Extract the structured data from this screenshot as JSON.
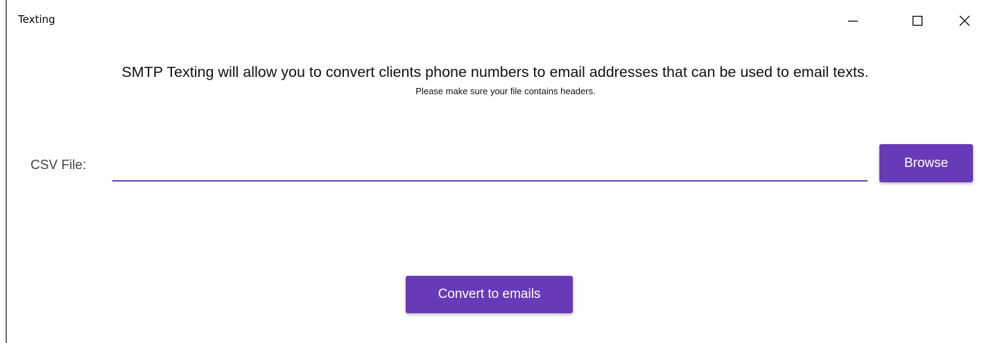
{
  "window": {
    "title": "Texting",
    "controls": {
      "minimize_icon": "minimize-icon",
      "maximize_icon": "maximize-icon",
      "close_icon": "close-icon"
    }
  },
  "main": {
    "description": "SMTP Texting will allow you to convert clients phone numbers to email addresses that can be used to email texts.",
    "note": "Please make sure your file contains headers.",
    "csv_label": "CSV File:",
    "csv_value": "",
    "csv_placeholder": "",
    "browse_label": "Browse",
    "convert_label": "Convert to emails"
  },
  "colors": {
    "accent": "#673ab7",
    "button_text": "#ffffff"
  }
}
